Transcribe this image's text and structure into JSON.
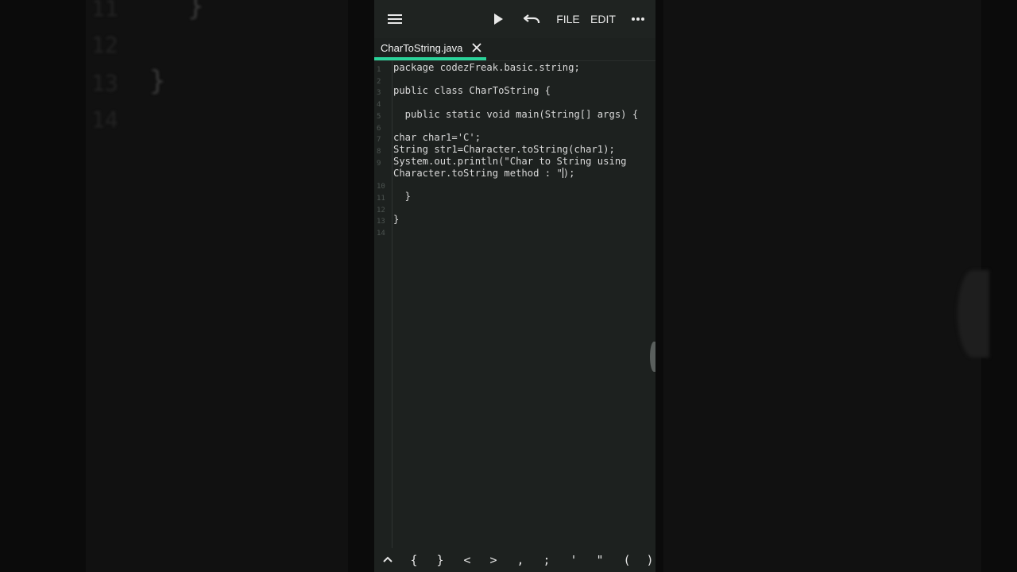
{
  "background": {
    "left_ghost_lines": [
      "11",
      "12",
      "13",
      "14"
    ],
    "left_ghost_braces": [
      "}",
      "}"
    ]
  },
  "toolbar": {
    "menu_icon": "hamburger-menu-icon",
    "run_icon": "play-icon",
    "undo_icon": "undo-icon",
    "file_label": "FILE",
    "edit_label": "EDIT",
    "more_icon": "more-horizontal-icon"
  },
  "tab": {
    "label": "CharToString.java",
    "close_icon": "close-icon",
    "accent_color": "#2bd39a"
  },
  "editor": {
    "line_numbers": [
      "1",
      "2",
      "3",
      "4",
      "5",
      "6",
      "7",
      "8",
      "9",
      "",
      "10",
      "11",
      "12",
      "13",
      "14"
    ],
    "code_lines": [
      "package codezFreak.basic.string;",
      "",
      "public class CharToString {",
      "",
      "  public static void main(String[] args) {",
      "",
      "char char1='C';",
      "String str1=Character.toString(char1);",
      "System.out.println(\"Char to String using",
      "Character.toString method : \"",
      "",
      "  }",
      "",
      "}",
      ""
    ],
    "line9_tail": ");"
  },
  "symbols": {
    "chevron_up": "^",
    "keys": [
      "{",
      "}",
      "<",
      ">",
      ",",
      ";",
      "'",
      "\"",
      "(",
      ")"
    ]
  }
}
